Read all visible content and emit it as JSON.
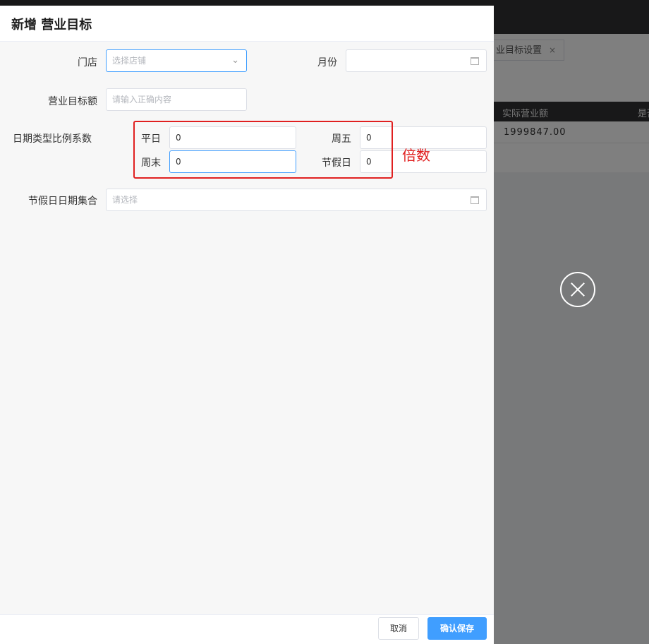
{
  "background": {
    "tab_label": "业目标设置",
    "tab_close": "×",
    "table_header_1": "实际营业额",
    "table_header_2": "是否",
    "row_value": "1999847.00"
  },
  "drawer": {
    "title": "新增 营业目标",
    "store": {
      "label": "门店",
      "placeholder": "选择店铺"
    },
    "month": {
      "label": "月份"
    },
    "target": {
      "label": "营业目标额",
      "placeholder": "请输入正确内容"
    },
    "ratio": {
      "label": "日期类型比例系数",
      "weekday": {
        "label": "平日",
        "value": "0"
      },
      "friday": {
        "label": "周五",
        "value": "0"
      },
      "weekend": {
        "label": "周末",
        "value": "0"
      },
      "holiday": {
        "label": "节假日",
        "value": "0"
      }
    },
    "holiday_dates": {
      "label": "节假日日期集合",
      "placeholder": "请选择"
    },
    "annotation": "倍数",
    "cancel_label": "取消",
    "save_label": "确认保存"
  },
  "colors": {
    "primary": "#409eff",
    "annotation": "#e02020"
  }
}
